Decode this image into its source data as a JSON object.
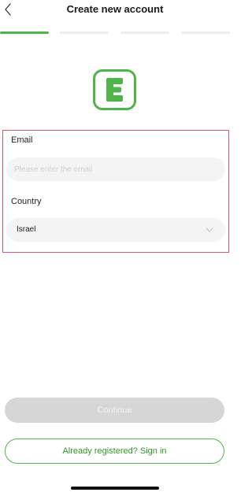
{
  "header": {
    "title": "Create new account",
    "back_icon": "chevron-left-icon"
  },
  "progress": {
    "total_steps": 4,
    "current_step": 1,
    "active_color": "#4fb548",
    "inactive_color": "#ededed"
  },
  "logo": {
    "icon": "app-logo-e-icon",
    "color": "#4fb548",
    "letter": "E"
  },
  "form": {
    "email_label": "Email",
    "email_placeholder": "Please enter the email",
    "email_value": "",
    "country_label": "Country",
    "country_value": "Israel",
    "country_chevron_icon": "chevron-down-icon"
  },
  "actions": {
    "continue_label": "Continue",
    "signin_label": "Already registered? Sign in"
  },
  "colors": {
    "accent": "#4fb548",
    "highlight_border": "#d9586b",
    "disabled_button": "#d6d6d6"
  }
}
